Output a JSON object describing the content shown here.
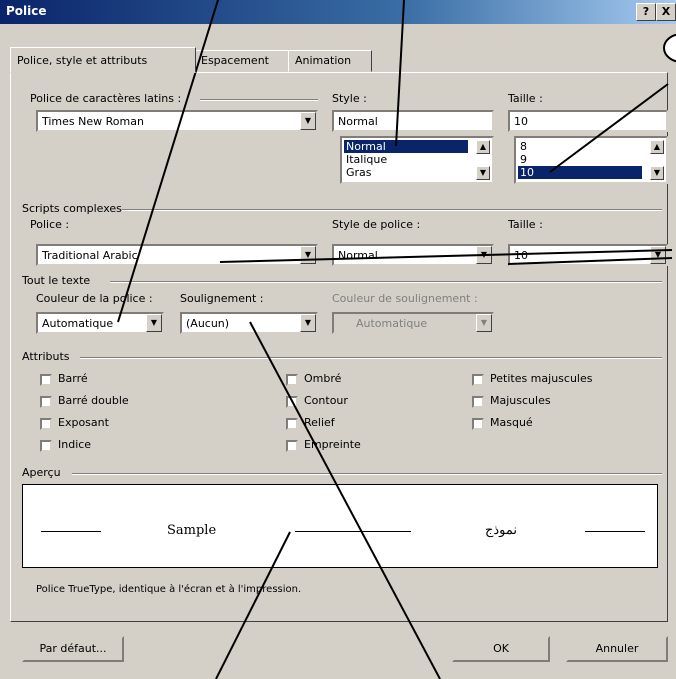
{
  "window": {
    "title": "Police",
    "help": "?",
    "close": "X"
  },
  "tabs": [
    {
      "label": "Police, style et attributs",
      "active": true
    },
    {
      "label": "Espacement",
      "active": false
    },
    {
      "label": "Animation",
      "active": false
    }
  ],
  "latin": {
    "font_label": "Police de caractères latins :",
    "font_value": "Times New Roman",
    "style_label": "Style :",
    "style_value": "Normal",
    "style_options": [
      "Normal",
      "Italique",
      "Gras"
    ],
    "size_label": "Taille :",
    "size_value": "10",
    "size_options": [
      "8",
      "9",
      "10"
    ]
  },
  "complex": {
    "group_label": "Scripts complexes",
    "font_label": "Police :",
    "font_value": "Traditional Arabic",
    "style_label": "Style de police :",
    "style_value": "Normal",
    "size_label": "Taille :",
    "size_value": "10"
  },
  "all_text": {
    "group_label": "Tout le texte",
    "color_label": "Couleur de la police :",
    "color_value": "Automatique",
    "underline_label": "Soulignement :",
    "underline_value": "(Aucun)",
    "underline_color_label": "Couleur de soulignement :",
    "underline_color_value": "Automatique"
  },
  "attributes": {
    "group_label": "Attributs",
    "items": [
      "Barré",
      "Barré double",
      "Exposant",
      "Indice",
      "Ombré",
      "Contour",
      "Relief",
      "Empreinte",
      "Petites majuscules",
      "Majuscules",
      "Masqué"
    ]
  },
  "preview": {
    "group_label": "Aperçu",
    "sample_latin": "Sample",
    "sample_arabic": "نموذج",
    "note": "Police TrueType, identique à l'écran et à l'impression."
  },
  "buttons": {
    "default": "Par défaut...",
    "ok": "OK",
    "cancel": "Annuler"
  }
}
